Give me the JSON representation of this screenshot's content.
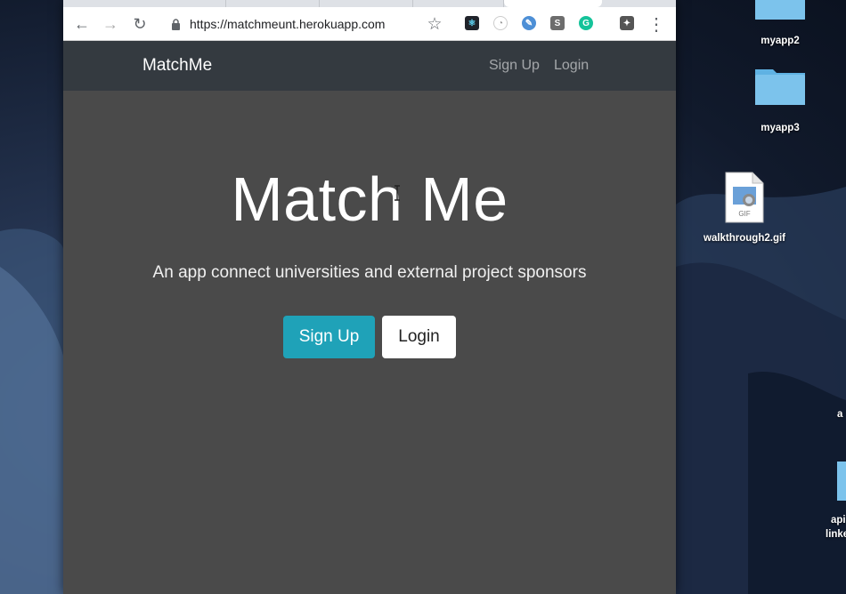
{
  "browser": {
    "url": "https://matchmeunt.herokuapp.com",
    "toolbar": {
      "back_icon": "←",
      "forward_icon": "→",
      "reload_icon": "↻",
      "star_icon": "☆",
      "menu_icon": "⋮"
    },
    "extensions": [
      {
        "name": "react-devtools-icon",
        "glyph": "⚛",
        "color": "#20232a"
      },
      {
        "name": "clock-extension-icon",
        "glyph": "◔",
        "color": "#e8e8e8"
      },
      {
        "name": "feather-extension-icon",
        "glyph": "✎",
        "color": "#4d8fd6"
      },
      {
        "name": "s-extension-icon",
        "glyph": "S",
        "color": "#6d6d6d"
      },
      {
        "name": "grammarly-icon",
        "glyph": "G",
        "color": "#15c39a"
      },
      {
        "name": "profile-extension-icon",
        "glyph": "✦",
        "color": "#555555"
      }
    ]
  },
  "navbar": {
    "brand": "MatchMe",
    "links": [
      "Sign Up",
      "Login"
    ]
  },
  "hero": {
    "title": "Match Me",
    "subtitle": "An app connect universities and external project sponsors",
    "signup_button": "Sign Up",
    "login_button": "Login"
  },
  "desktop": {
    "icons": [
      {
        "label": "myapp2",
        "type": "folder"
      },
      {
        "label": "myapp3",
        "type": "folder"
      },
      {
        "label": "walkthrough2.gif",
        "type": "gif",
        "badge": "GIF"
      },
      {
        "label": "a",
        "type": "partial"
      },
      {
        "label": "api",
        "type": "folder-partial"
      },
      {
        "label": "linke",
        "type": "folder-partial"
      }
    ]
  },
  "colors": {
    "navbar_bg": "#343a40",
    "page_bg": "#4a4a4a",
    "primary": "#1fa2b8"
  }
}
